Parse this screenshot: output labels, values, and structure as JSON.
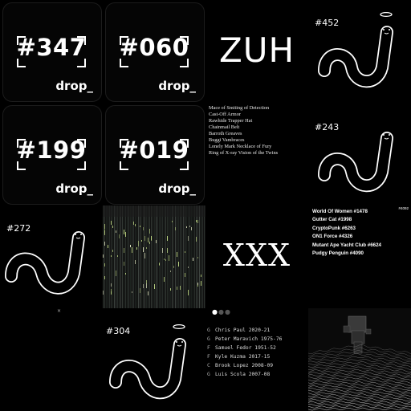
{
  "drops": [
    {
      "number": "#347",
      "logo": "drop_"
    },
    {
      "number": "#060",
      "logo": "drop_"
    },
    {
      "number": "#199",
      "logo": "drop_"
    },
    {
      "number": "#019",
      "logo": "drop_"
    }
  ],
  "zuh": "ZUH",
  "xxx": "XXX",
  "worms": [
    {
      "label": "#452"
    },
    {
      "label": "#243"
    },
    {
      "label": "#272"
    },
    {
      "label": "#304"
    }
  ],
  "loot_items": [
    "Mace of Smiting of Detection",
    "Cast-Off Armor",
    "Rawhide Trapper Hat",
    "Chainmail Belt",
    "Barroth Greaves",
    "Buggi Vambraces",
    "Lonely Mark Necklace of Fury",
    "Ring of X-ray Vision of the Twins"
  ],
  "nft_list": [
    "World Of Women #1478",
    "Gutter Cat #1998",
    "CryptoPunk #6263",
    "ON1 Force #4326",
    "Mutant Ape Yacht Club #6624",
    "Pudgy Penguin #4090"
  ],
  "nft_id": "#4092",
  "small_mark": "×",
  "dots": [
    "●",
    "●",
    "●"
  ],
  "players": [
    {
      "pos": "G",
      "text": "Chris Paul 2020-21"
    },
    {
      "pos": "G",
      "text": "Peter Maravich 1975-76"
    },
    {
      "pos": "F",
      "text": "Samuel Fedor 1951-52"
    },
    {
      "pos": "F",
      "text": "Kyle Kuzma 2017-15"
    },
    {
      "pos": "C",
      "text": "Brook Lopez 2008-09"
    },
    {
      "pos": "G",
      "text": "Luis Scola 2007-08"
    }
  ],
  "colors": {
    "background": "#000000",
    "foreground": "#ffffff",
    "matrix_green": "#c6e08a"
  },
  "icons": [
    "halo-icon",
    "worm-icon",
    "corner-bracket-icon"
  ]
}
